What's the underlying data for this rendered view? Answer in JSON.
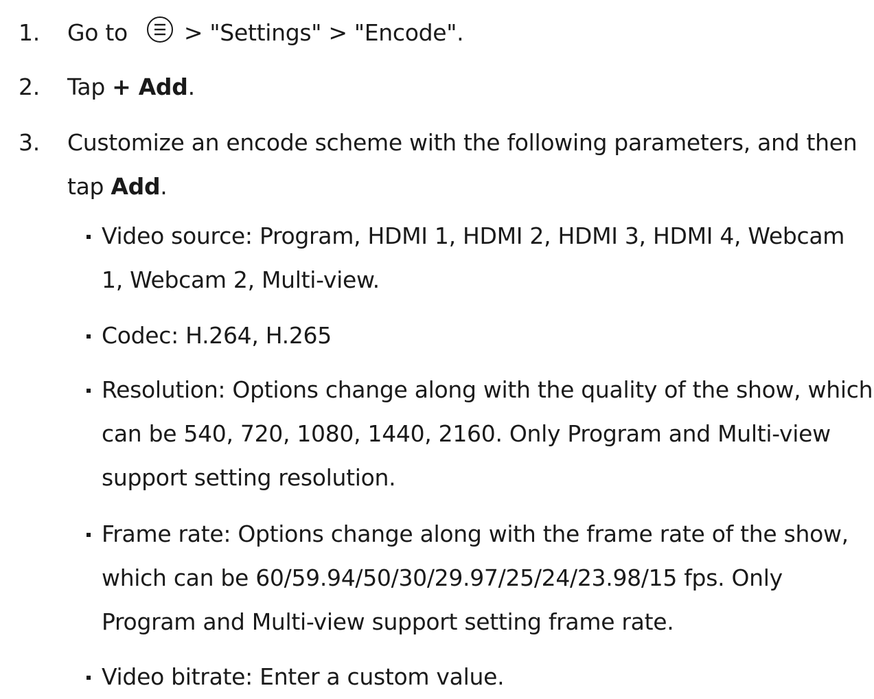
{
  "steps": [
    {
      "number": "1.",
      "prefix": "Go to",
      "icon": "menu-icon",
      "suffix": "> \"Settings\" > \"Encode\"."
    },
    {
      "number": "2.",
      "prefix": "Tap ",
      "bold": "+ Add",
      "suffix": "."
    },
    {
      "number": "3.",
      "line1": "Customize an encode scheme with the following parameters, and then",
      "line2_prefix": "tap ",
      "line2_bold": "Add",
      "line2_suffix": "."
    }
  ],
  "parameters": [
    {
      "lines": [
        "Video source: Program, HDMI 1, HDMI 2, HDMI 3, HDMI 4, Webcam",
        "1, Webcam 2, Multi-view."
      ]
    },
    {
      "lines": [
        "Codec: H.264, H.265"
      ]
    },
    {
      "lines": [
        "Resolution: Options change along with the quality of the show, which",
        "can be 540, 720, 1080, 1440, 2160. Only Program and Multi-view",
        "support setting resolution."
      ]
    },
    {
      "lines": [
        "Frame rate: Options change along with the frame rate of the show,",
        "which can be 60/59.94/50/30/29.97/25/24/23.98/15 fps. Only",
        "Program and Multi-view support setting frame rate."
      ]
    },
    {
      "lines": [
        "Video bitrate: Enter a custom value."
      ]
    }
  ]
}
